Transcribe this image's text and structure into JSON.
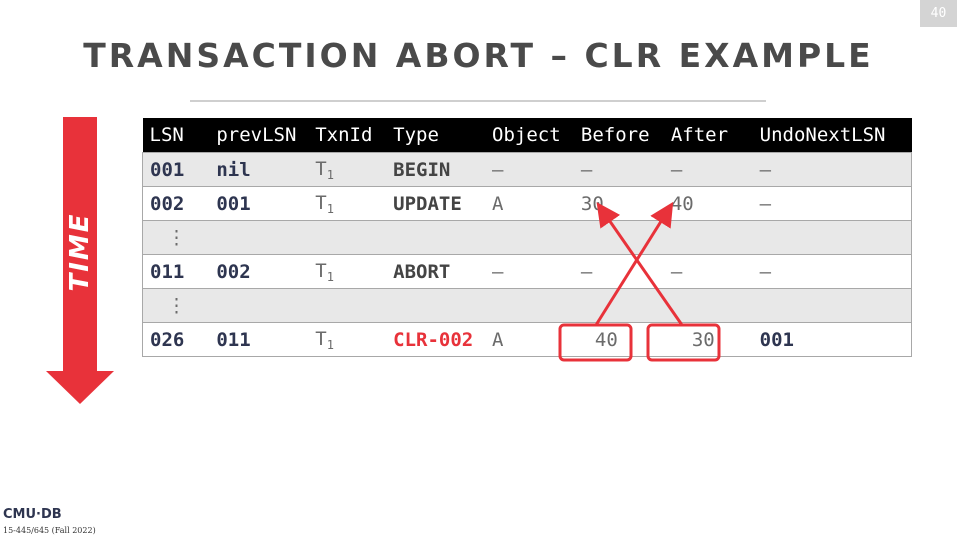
{
  "slide_number": "40",
  "title": "TRANSACTION ABORT – CLR EXAMPLE",
  "time_label": "TIME",
  "log": {
    "headers": [
      "LSN",
      "prevLSN",
      "TxnId",
      "Type",
      "Object",
      "Before",
      "After",
      "UndoNextLSN"
    ],
    "rows": [
      {
        "lsn": "001",
        "prev": "nil",
        "txn": "T",
        "txn_sub": "1",
        "type": "BEGIN",
        "object": "–",
        "before": "–",
        "after": "–",
        "undo": "–"
      },
      {
        "lsn": "002",
        "prev": "001",
        "txn": "T",
        "txn_sub": "1",
        "type": "UPDATE",
        "object": "A",
        "before": "30",
        "after": "40",
        "undo": "–"
      },
      {
        "ellipsis": "⋮"
      },
      {
        "lsn": "011",
        "prev": "002",
        "txn": "T",
        "txn_sub": "1",
        "type": "ABORT",
        "object": "–",
        "before": "–",
        "after": "–",
        "undo": "–"
      },
      {
        "ellipsis": "⋮"
      },
      {
        "lsn": "026",
        "prev": "011",
        "txn": "T",
        "txn_sub": "1",
        "type": "CLR-002",
        "object": "A",
        "before": "40",
        "after": "30",
        "undo": "001"
      }
    ]
  },
  "colors": {
    "accent_red": "#e8323a",
    "header_bg": "#000000",
    "navy": "#2e3550"
  },
  "footer": {
    "logo": "CMU·DB",
    "course": "15-445/645 (Fall 2022)"
  }
}
